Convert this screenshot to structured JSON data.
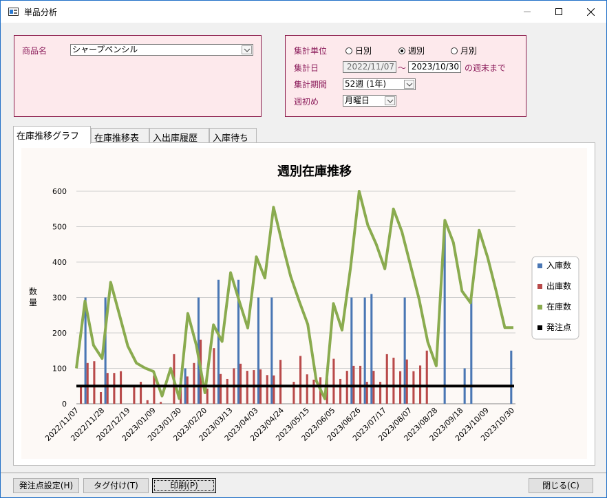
{
  "window": {
    "title": "単品分析"
  },
  "product": {
    "label": "商品名",
    "value": "シャープペンシル"
  },
  "settings": {
    "unit_label": "集計単位",
    "unit_options": [
      "日別",
      "週別",
      "月別"
    ],
    "unit_selected": "週別",
    "date_label": "集計日",
    "date_from": "2022/11/07",
    "tilde": "～",
    "date_to": "2023/10/30",
    "date_suffix": "の週末まで",
    "period_label": "集計期間",
    "period_value": "52週 (1年)",
    "weekstart_label": "週初め",
    "weekstart_value": "月曜日"
  },
  "tabs": [
    "在庫推移グラフ",
    "在庫推移表",
    "入出庫履歴",
    "入庫待ち"
  ],
  "buttons": {
    "order_point": "発注点設定(H)",
    "tag": "タグ付け(T)",
    "print": "印刷(P)",
    "close": "閉じる(C)"
  },
  "colors": {
    "inbound": "#4a77b4",
    "outbound": "#b94a4a",
    "stock": "#8aab4f",
    "order_point": "#000000"
  },
  "chart_data": {
    "type": "bar",
    "title": "週別在庫推移",
    "ylabel": "数量",
    "ylim": [
      0,
      600
    ],
    "yticks": [
      0,
      100,
      200,
      300,
      400,
      500,
      600
    ],
    "legend_position": "right",
    "grid": true,
    "x_tick_labels": [
      "2022/11/07",
      "2022/11/28",
      "2022/12/19",
      "2023/01/09",
      "2023/01/30",
      "2023/02/20",
      "2023/03/13",
      "2023/04/03",
      "2023/04/24",
      "2023/05/15",
      "2023/06/05",
      "2023/06/26",
      "2023/07/17",
      "2023/08/07",
      "2023/08/28",
      "2023/09/18",
      "2023/10/09",
      "2023/10/30"
    ],
    "series": [
      {
        "name": "入庫数",
        "kind": "bar",
        "values": [
          0,
          300,
          0,
          0,
          300,
          0,
          0,
          0,
          0,
          0,
          0,
          0,
          0,
          0,
          0,
          0,
          100,
          0,
          300,
          0,
          0,
          350,
          0,
          0,
          350,
          0,
          0,
          300,
          0,
          300,
          0,
          0,
          0,
          0,
          0,
          0,
          0,
          0,
          0,
          0,
          0,
          300,
          0,
          300,
          310,
          0,
          0,
          0,
          0,
          300,
          0,
          0,
          0,
          0,
          0,
          500,
          0,
          0,
          100,
          300,
          0,
          0,
          0,
          0,
          0,
          150
        ]
      },
      {
        "name": "出庫数",
        "kind": "bar",
        "values": [
          50,
          115,
          120,
          33,
          87,
          87,
          92,
          0,
          48,
          62,
          10,
          80,
          5,
          0,
          140,
          73,
          77,
          115,
          181,
          43,
          157,
          84,
          70,
          100,
          113,
          93,
          95,
          97,
          81,
          80,
          124,
          0,
          62,
          135,
          83,
          68,
          75,
          72,
          127,
          70,
          93,
          107,
          107,
          62,
          93,
          62,
          140,
          130,
          92,
          125,
          92,
          108,
          150,
          0,
          0,
          0,
          0,
          0,
          0,
          0,
          0,
          0,
          0,
          0,
          0,
          0
        ]
      },
      {
        "name": "在庫数",
        "kind": "line",
        "values": [
          100,
          290,
          165,
          128,
          343,
          253,
          163,
          115,
          101,
          91,
          22,
          100,
          15,
          255,
          165,
          31,
          223,
          176,
          370,
          290,
          214,
          415,
          355,
          555,
          455,
          360,
          290,
          224,
          65,
          14,
          283,
          208,
          385,
          600,
          505,
          450,
          381,
          550,
          485,
          390,
          295,
          175,
          107,
          518,
          455,
          318,
          285,
          490,
          413,
          317,
          215,
          215
        ]
      },
      {
        "name": "発注点",
        "kind": "line",
        "values": [
          50
        ]
      }
    ]
  }
}
